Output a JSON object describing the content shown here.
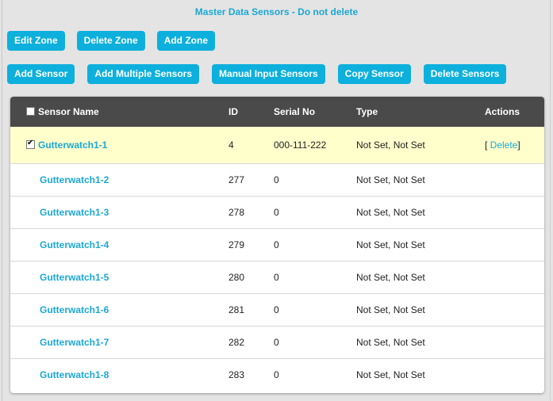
{
  "page": {
    "title": "Master Data Sensors - Do not delete"
  },
  "zone_buttons": [
    {
      "label": "Edit Zone"
    },
    {
      "label": "Delete Zone"
    },
    {
      "label": "Add Zone"
    }
  ],
  "sensor_buttons": [
    {
      "label": "Add Sensor"
    },
    {
      "label": "Add Multiple Sensors"
    },
    {
      "label": "Manual Input Sensors"
    },
    {
      "label": "Copy Sensor"
    },
    {
      "label": "Delete Sensors"
    }
  ],
  "table": {
    "columns": [
      "Sensor Name",
      "ID",
      "Serial No",
      "Type",
      "Actions"
    ],
    "select_all_checked": false,
    "rows": [
      {
        "name": "Gutterwatch1-1",
        "id": "4",
        "serial": "000-111-222",
        "type": "Not Set, Not Set",
        "checked": true,
        "action_open": "[ ",
        "action_label": "Delete",
        "action_close": "]"
      },
      {
        "name": "Gutterwatch1-2",
        "id": "277",
        "serial": "0",
        "type": "Not Set, Not Set"
      },
      {
        "name": "Gutterwatch1-3",
        "id": "278",
        "serial": "0",
        "type": "Not Set, Not Set"
      },
      {
        "name": "Gutterwatch1-4",
        "id": "279",
        "serial": "0",
        "type": "Not Set, Not Set"
      },
      {
        "name": "Gutterwatch1-5",
        "id": "280",
        "serial": "0",
        "type": "Not Set, Not Set"
      },
      {
        "name": "Gutterwatch1-6",
        "id": "281",
        "serial": "0",
        "type": "Not Set, Not Set"
      },
      {
        "name": "Gutterwatch1-7",
        "id": "282",
        "serial": "0",
        "type": "Not Set, Not Set"
      },
      {
        "name": "Gutterwatch1-8",
        "id": "283",
        "serial": "0",
        "type": "Not Set, Not Set"
      }
    ]
  },
  "colors": {
    "accent": "#0db0dc",
    "link": "#1ba7d4",
    "header_bg": "#4a4a4a",
    "selected_row_bg": "#ffffcc",
    "page_bg": "#e4e4e4"
  }
}
